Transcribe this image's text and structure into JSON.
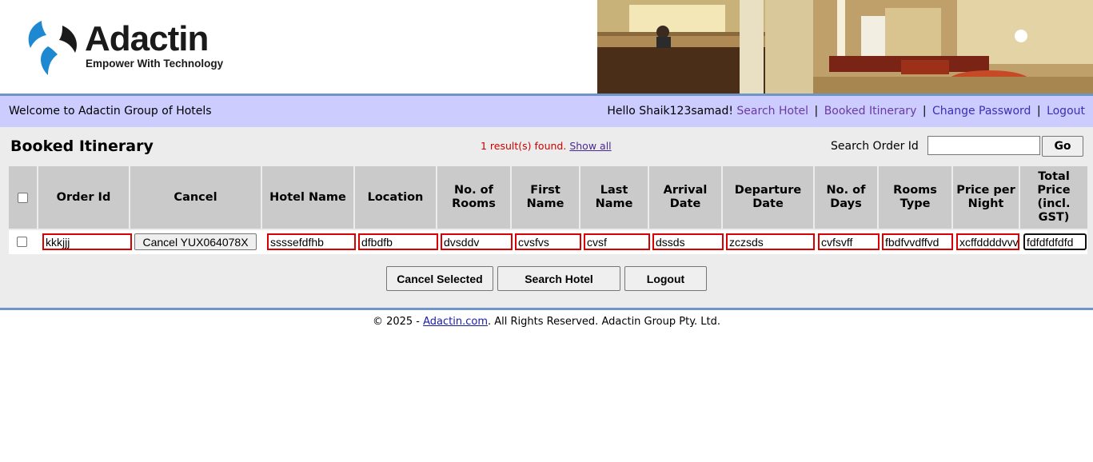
{
  "brand": {
    "name": "Adactin",
    "tagline": "Empower With Technology"
  },
  "welcome_bar": {
    "welcome_text": "Welcome to Adactin Group of Hotels",
    "greeting": "Hello Shaik123samad!",
    "links": [
      "Search Hotel",
      "Booked Itinerary",
      "Change Password",
      "Logout"
    ],
    "separator": "|"
  },
  "page": {
    "title": "Booked Itinerary",
    "results_text": "1 result(s) found.",
    "show_all": "Show all",
    "search_order_label": "Search Order Id",
    "search_order_value": "",
    "go_label": "Go"
  },
  "table": {
    "headers": [
      "Order Id",
      "Cancel",
      "Hotel Name",
      "Location",
      "No. of Rooms",
      "First Name",
      "Last Name",
      "Arrival Date",
      "Departure Date",
      "No. of Days",
      "Rooms Type",
      "Price per Night",
      "Total Price (incl. GST)"
    ],
    "row": {
      "order_id": "kkkjjj",
      "cancel_label": "Cancel YUX064078X",
      "hotel_name": "ssssefdfhb",
      "location": "dfbdfb",
      "rooms": "dvsddv",
      "first_name": "cvsfvs",
      "last_name": "cvsf",
      "arrival_date": "dssds",
      "departure_date": "zczsds",
      "days": "cvfsvff",
      "rooms_type": "fbdfvvdffvd",
      "price_per_night": "xcffddddvvv",
      "total_price": "fdfdfdfdfd"
    }
  },
  "actions": {
    "cancel_selected": "Cancel Selected",
    "search_hotel": "Search Hotel",
    "logout": "Logout"
  },
  "footer": {
    "prefix": "© 2025 - ",
    "link": "Adactin.com",
    "suffix": ". All Rights Reserved. Adactin Group Pty. Ltd."
  },
  "colors": {
    "welcome_bar": "#ccccff",
    "accent_line": "#6f95c8",
    "header_cell": "#cacaca",
    "error_border": "#d80000",
    "link": "#3b2fb6"
  }
}
